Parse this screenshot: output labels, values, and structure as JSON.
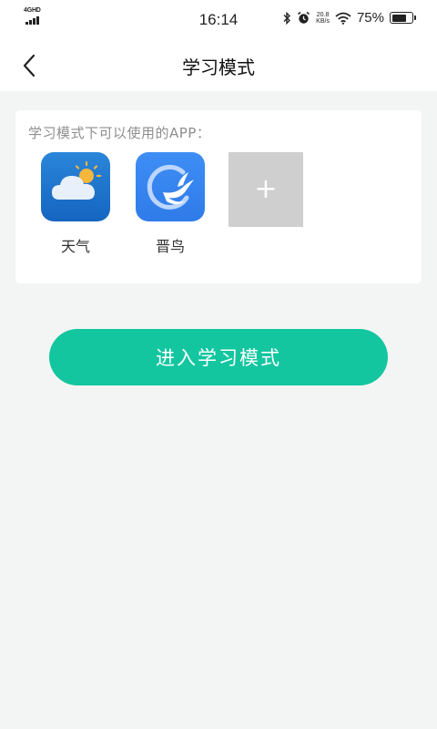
{
  "status_bar": {
    "network": "4GHD",
    "time": "16:14",
    "speed_value": "20.8",
    "speed_unit": "KB/s",
    "battery_percent": "75%",
    "battery_level": 0.75
  },
  "nav": {
    "title": "学习模式"
  },
  "card": {
    "hint": "学习模式下可以使用的APP：",
    "apps": [
      {
        "label": "天气",
        "icon": "weather-icon"
      },
      {
        "label": "晋鸟",
        "icon": "bird-app-icon"
      }
    ],
    "add_label": "+"
  },
  "actions": {
    "enter_label": "进入学习模式"
  },
  "colors": {
    "accent": "#13c69f",
    "background": "#f3f5f4",
    "add_tile": "#cfcfcf"
  }
}
